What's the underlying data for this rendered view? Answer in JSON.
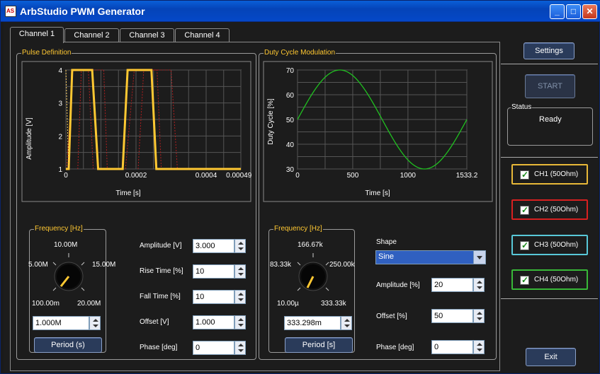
{
  "window": {
    "title": "ArbStudio PWM Generator",
    "min": "_",
    "max": "□",
    "close": "✕"
  },
  "tabs": [
    "Channel 1",
    "Channel 2",
    "Channel 3",
    "Channel 4"
  ],
  "pulse": {
    "group": "Pulse Definition",
    "chart_data": {
      "type": "line",
      "xlabel": "Time [s]",
      "ylabel": "Amplitude [V]",
      "xticks": [
        "0",
        "0.0002",
        "0.0004",
        "0.000499"
      ],
      "yticks": [
        "1",
        "2",
        "3",
        "4"
      ],
      "xlim": [
        0,
        0.000499
      ],
      "ylim": [
        1,
        4
      ],
      "series": [
        {
          "values_x": [
            0,
            7.5e-06,
            1.2e-05,
            2.5e-05,
            4e-05,
            4.5e-05,
            7e-05,
            7.7e-05,
            8.2e-05,
            0.000105,
            0.000118,
            0.000128,
            0.000135,
            0.00015
          ],
          "values_y": [
            1,
            1,
            4,
            4,
            4,
            4,
            4,
            4,
            4,
            4,
            4,
            1,
            1,
            1
          ]
        }
      ]
    },
    "freq_group": "Frequency [Hz]",
    "knob": {
      "top": "10.00M",
      "left": "5.00M",
      "right": "15.00M",
      "bl": "100.00m",
      "br": "20.00M"
    },
    "freq_value": "1.000M",
    "period_button": "Period (s)",
    "fields": [
      {
        "label": "Amplitude [V]",
        "value": "3.000"
      },
      {
        "label": "Rise Time [%]",
        "value": "10"
      },
      {
        "label": "Fall Time [%]",
        "value": "10"
      },
      {
        "label": "Offset [V]",
        "value": "1.000"
      },
      {
        "label": "Phase [deg]",
        "value": "0"
      }
    ]
  },
  "duty": {
    "group": "Duty Cycle Modulation",
    "chart_data": {
      "type": "line",
      "xlabel": "Time [s]",
      "ylabel": "Duty Cycle [%]",
      "xticks": [
        "0",
        "500",
        "1000",
        "1533.2"
      ],
      "yticks": [
        "30",
        "40",
        "50",
        "60",
        "70"
      ],
      "xlim": [
        0,
        1533.2
      ],
      "ylim": [
        30,
        70
      ],
      "series": [
        {
          "shape": "sine",
          "amplitude": 20,
          "offset": 50
        }
      ]
    },
    "freq_group": "Frequency [Hz]",
    "knob": {
      "top": "166.67k",
      "left": "83.33k",
      "right": "250.00k",
      "bl": "10.00µ",
      "br": "333.33k"
    },
    "freq_value": "333.298m",
    "period_button": "Period [s]",
    "shape_label": "Shape",
    "shape_value": "Sine",
    "fields": [
      {
        "label": "Amplitude [%]",
        "value": "20"
      },
      {
        "label": "Offset [%]",
        "value": "50"
      },
      {
        "label": "Phase [deg]",
        "value": "0"
      }
    ]
  },
  "side": {
    "settings": "Settings",
    "start": "START",
    "status_label": "Status",
    "status_value": "Ready",
    "channels": [
      {
        "label": "CH1 (50Ohm)",
        "color": "#e8b838"
      },
      {
        "label": "CH2 (50Ohm)",
        "color": "#d82020"
      },
      {
        "label": "CH3 (50Ohm)",
        "color": "#58c8d8"
      },
      {
        "label": "CH4 (50Ohm)",
        "color": "#38b838"
      }
    ],
    "exit": "Exit"
  }
}
